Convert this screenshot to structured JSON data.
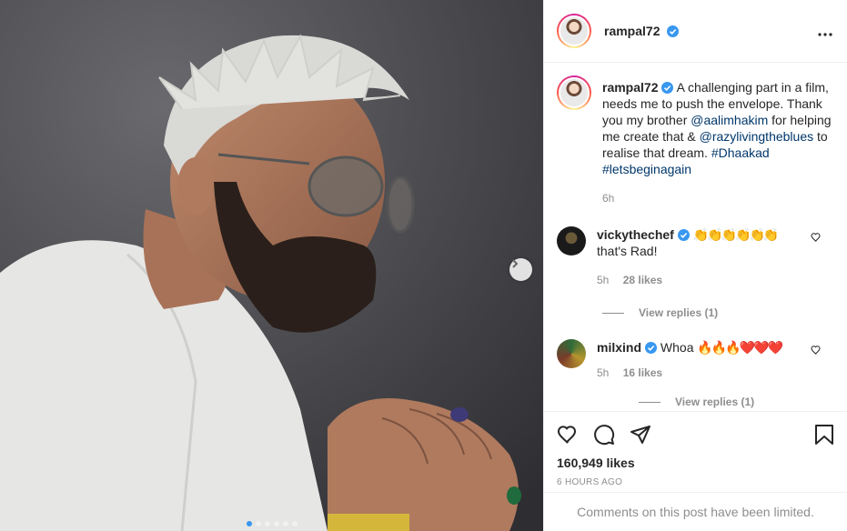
{
  "post": {
    "author": "rampal72",
    "caption_parts": {
      "text1": " A challenging part in a film, needs me to push the envelope. Thank you my brother ",
      "mention1": "@aalimhakim",
      "text2": " for helping me create that & ",
      "mention2": "@razylivingtheblues",
      "text3": " to realise that dream. ",
      "hashtag1": "#Dhaakad",
      "hashtag2": "#letsbeginagain"
    },
    "caption_time": "6h",
    "likes": "160,949 likes",
    "posted_ago": "6 HOURS AGO",
    "comments_limited": "Comments on this post have been limited.",
    "carousel": {
      "slides": 6,
      "active_index": 0
    }
  },
  "comments": [
    {
      "username": "vickythechef",
      "emoji": "👏👏👏👏👏👏",
      "text": "that's Rad!",
      "time": "5h",
      "likes": "28 likes",
      "view_replies": "View replies (1)"
    },
    {
      "username": "milxind",
      "text": "Whoa",
      "emoji": "🔥🔥🔥❤️❤️❤️",
      "time": "5h",
      "likes": "16 likes",
      "view_replies": "View replies (1)"
    }
  ],
  "colors": {
    "verified": "#3897f0",
    "link": "#00376b",
    "muted": "#8e8e8e"
  },
  "icons": [
    "more-icon",
    "heart-icon",
    "comment-icon",
    "share-icon",
    "save-icon",
    "verified-icon",
    "chevron-right-icon"
  ]
}
